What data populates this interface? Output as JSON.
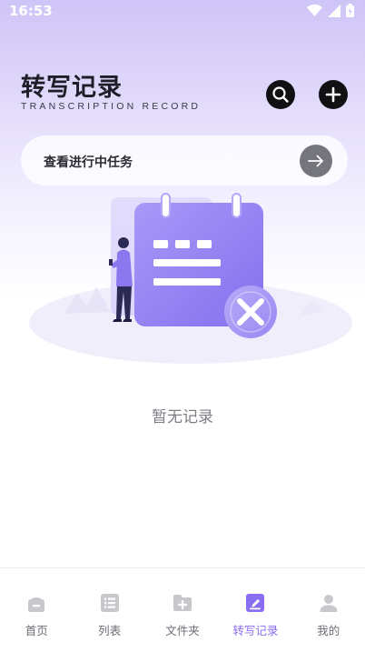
{
  "status_bar": {
    "time": "16:53"
  },
  "header": {
    "title": "转写记录",
    "subtitle": "TRANSCRIPTION RECORD"
  },
  "task_bar": {
    "label": "查看进行中任务"
  },
  "empty_state": {
    "message": "暂无记录"
  },
  "tabs": [
    {
      "label": "首页",
      "icon": "home-icon",
      "active": false
    },
    {
      "label": "列表",
      "icon": "list-icon",
      "active": false
    },
    {
      "label": "文件夹",
      "icon": "folder-add-icon",
      "active": false
    },
    {
      "label": "转写记录",
      "icon": "edit-document-icon",
      "active": true
    },
    {
      "label": "我的",
      "icon": "user-icon",
      "active": false
    }
  ],
  "colors": {
    "accent": "#8a6ef0",
    "inactive_icon": "#c8c8cc",
    "header_gradient_top": "#cfc4f7"
  }
}
